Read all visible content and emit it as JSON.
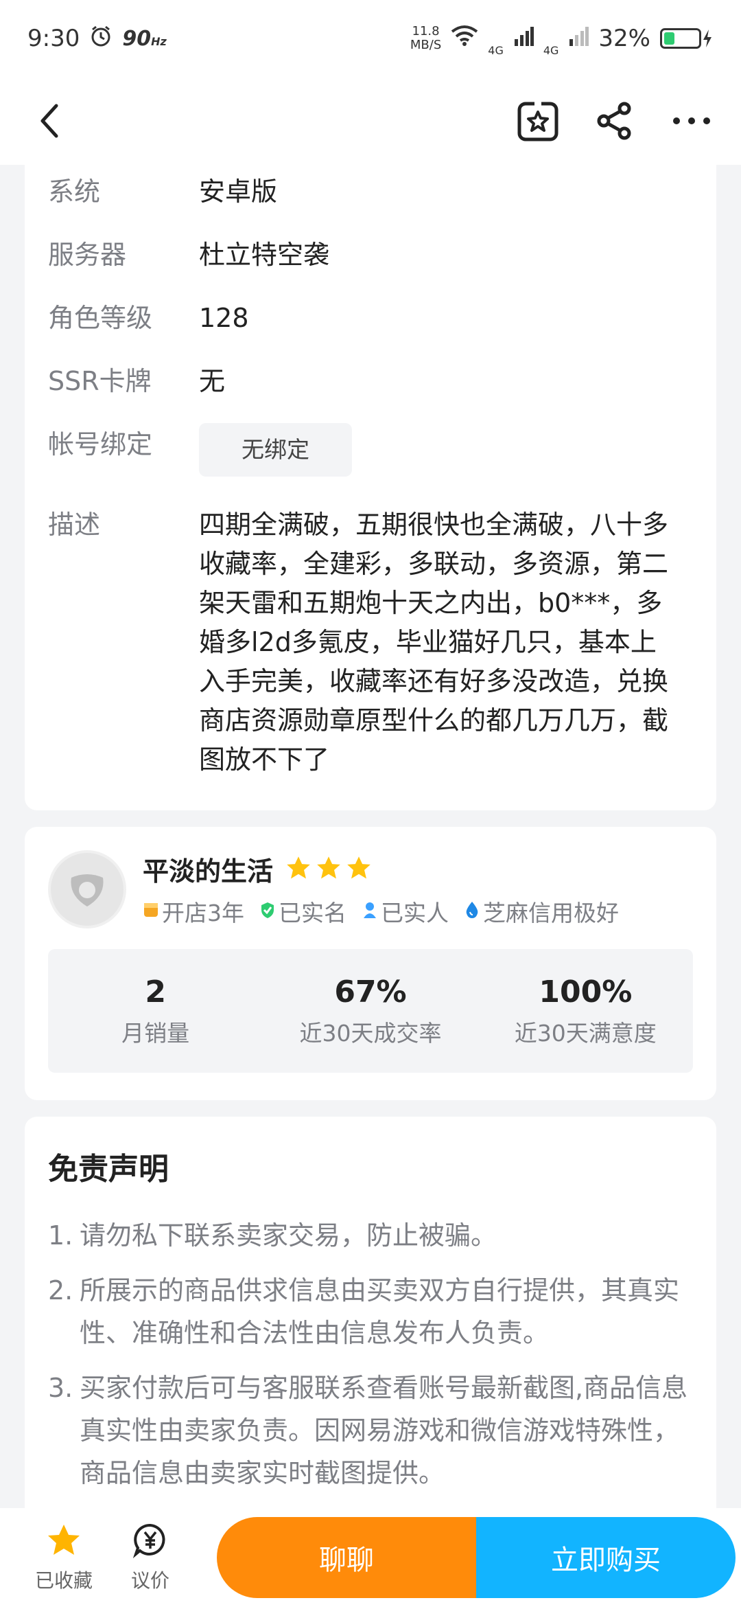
{
  "status_bar": {
    "time": "9:30",
    "refresh_rate": "90",
    "refresh_unit": "Hz",
    "net_speed_value": "11.8",
    "net_speed_unit": "MB/S",
    "net1": "4G",
    "net2": "4G",
    "battery_pct": "32%",
    "battery_level": 0.32
  },
  "header": {
    "back_icon": "back-arrow-icon",
    "favorite_icon": "star-box-icon",
    "share_icon": "share-icon",
    "more_icon": "more-dots-icon"
  },
  "info": {
    "rows": [
      {
        "label": "系统",
        "value": "安卓版"
      },
      {
        "label": "服务器",
        "value": "杜立特空袭"
      },
      {
        "label": "角色等级",
        "value": "128"
      },
      {
        "label": "SSR卡牌",
        "value": "无"
      }
    ],
    "binding_label": "帐号绑定",
    "binding_value": "无绑定",
    "desc_label": "描述",
    "desc_text": "四期全满破，五期很快也全满破，八十多收藏率，全建彩，多联动，多资源，第二架天雷和五期炮十天之内出，b0***，多婚多l2d多氪皮，毕业猫好几只，基本上入手完美，收藏率还有好多没改造，兑换商店资源勋章原型什么的都几万几万，截图放不下了"
  },
  "seller": {
    "name": "平淡的生活",
    "stars": 3,
    "badges": [
      {
        "icon": "shop-icon",
        "label": "开店3年",
        "color": "#f5a623"
      },
      {
        "icon": "verified-shield-icon",
        "label": "已实名",
        "color": "#2ecc71"
      },
      {
        "icon": "person-icon",
        "label": "已实人",
        "color": "#3aa0ff"
      },
      {
        "icon": "drop-icon",
        "label": "芝麻信用极好",
        "color": "#1e88e5"
      }
    ],
    "stats": [
      {
        "value": "2",
        "label": "月销量"
      },
      {
        "value": "67%",
        "label": "近30天成交率"
      },
      {
        "value": "100%",
        "label": "近30天满意度"
      }
    ]
  },
  "disclaimer": {
    "title": "免责声明",
    "items": [
      {
        "num": "1.",
        "text": "请勿私下联系卖家交易，防止被骗。"
      },
      {
        "num": "2.",
        "text": "所展示的商品供求信息由买卖双方自行提供，其真实性、准确性和合法性由信息发布人负责。"
      },
      {
        "num": "3.",
        "text": "买家付款后可与客服联系查看账号最新截图,商品信息真实性由卖家负责。因网易游戏和微信游戏特殊性，商品信息由卖家实时截图提供。"
      }
    ]
  },
  "bottom_bar": {
    "favorited_label": "已收藏",
    "bargain_label": "议价",
    "chat_label": "聊聊",
    "buy_label": "立即购买",
    "accent_orange": "#ff8b0a",
    "accent_blue": "#12b4ff"
  }
}
